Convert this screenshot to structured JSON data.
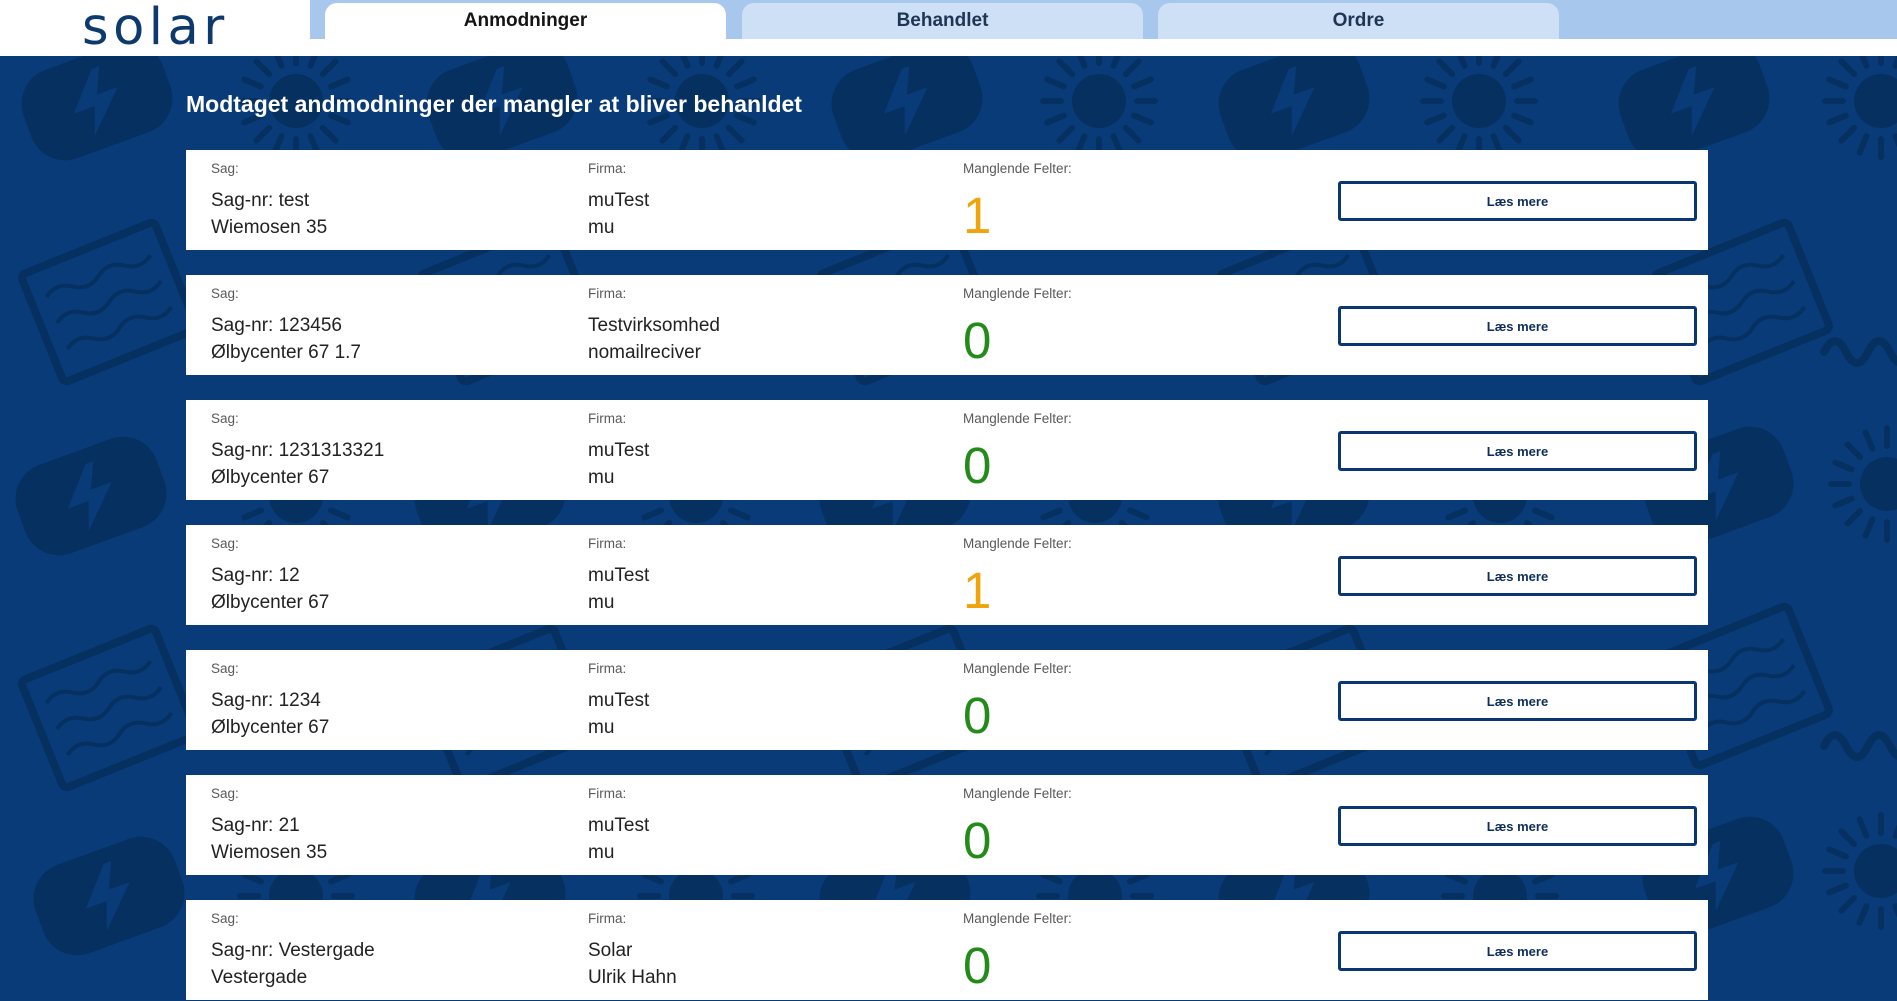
{
  "brand": {
    "logo_text": "solar"
  },
  "tabs": [
    {
      "label": "Anmodninger",
      "active": true
    },
    {
      "label": "Behandlet",
      "active": false
    },
    {
      "label": "Ordre",
      "active": false
    }
  ],
  "page": {
    "heading": "Modtaget andmodninger der mangler at bliver behanldet"
  },
  "labels": {
    "case": "Sag:",
    "company": "Firma:",
    "missing_fields": "Manglende Felter:",
    "read_more": "Læs mere"
  },
  "requests": [
    {
      "case_number": "Sag-nr: test",
      "address": "Wiemosen 35",
      "company": "muTest",
      "contact": "mu",
      "missing_fields": 1
    },
    {
      "case_number": "Sag-nr: 123456",
      "address": "Ølbycenter 67 1.7",
      "company": "Testvirksomhed",
      "contact": "nomailreciver",
      "missing_fields": 0
    },
    {
      "case_number": "Sag-nr: 1231313321",
      "address": "Ølbycenter 67",
      "company": "muTest",
      "contact": "mu",
      "missing_fields": 0
    },
    {
      "case_number": "Sag-nr: 12",
      "address": "Ølbycenter 67",
      "company": "muTest",
      "contact": "mu",
      "missing_fields": 1
    },
    {
      "case_number": "Sag-nr: 1234",
      "address": "Ølbycenter 67",
      "company": "muTest",
      "contact": "mu",
      "missing_fields": 0
    },
    {
      "case_number": "Sag-nr: 21",
      "address": "Wiemosen 35",
      "company": "muTest",
      "contact": "mu",
      "missing_fields": 0
    },
    {
      "case_number": "Sag-nr: Vestergade",
      "address": "Vestergade",
      "company": "Solar",
      "contact": "Ulrik Hahn",
      "missing_fields": 0
    }
  ],
  "icons": {
    "background_pattern": [
      "sun-icon",
      "plug-icon",
      "solar-panel-icon",
      "cable-icon"
    ]
  },
  "colors": {
    "background": "#0a3b79",
    "pattern": "#06305f",
    "accent": "#0b3770",
    "tab_strip": "#a8c7ed",
    "tab_inactive": "#cde0f6",
    "missing_warning": "#f0a30a",
    "missing_ok": "#238b19"
  }
}
